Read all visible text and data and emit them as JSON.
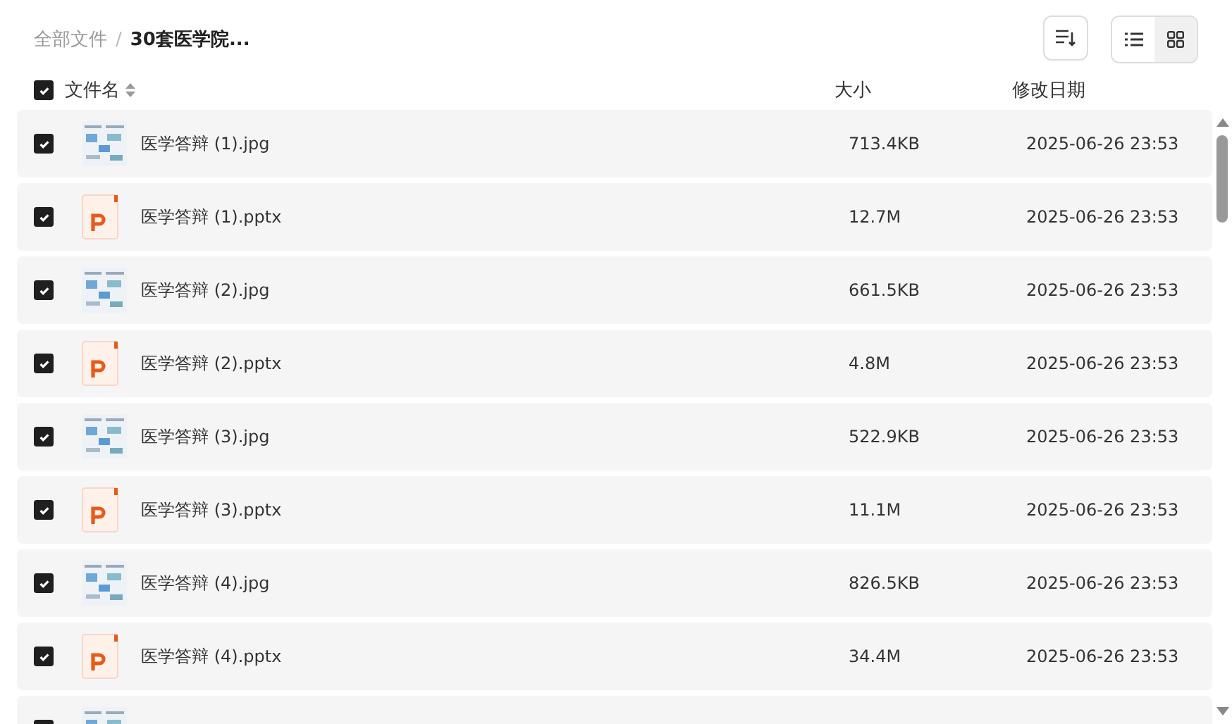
{
  "breadcrumb_separator": "/",
  "breadcrumb": [
    {
      "label": "全部文件",
      "current": false
    },
    {
      "label": "30套医学院...",
      "current": true
    }
  ],
  "view_toggle": [
    {
      "kind": "list",
      "selected": false
    },
    {
      "kind": "grid",
      "selected": true
    }
  ],
  "header": {
    "checked": true,
    "columns": [
      "文件名",
      "大小",
      "修改日期"
    ]
  },
  "files": [
    {
      "kind": "image",
      "checked": true,
      "name": "医学答辩 (1).jpg",
      "size": "713.4KB",
      "date": "2025-06-26 23:53"
    },
    {
      "kind": "pptx",
      "checked": true,
      "name": "医学答辩 (1).pptx",
      "size": "12.7M",
      "date": "2025-06-26 23:53"
    },
    {
      "kind": "image",
      "checked": true,
      "name": "医学答辩 (2).jpg",
      "size": "661.5KB",
      "date": "2025-06-26 23:53"
    },
    {
      "kind": "pptx",
      "checked": true,
      "name": "医学答辩 (2).pptx",
      "size": "4.8M",
      "date": "2025-06-26 23:53"
    },
    {
      "kind": "image",
      "checked": true,
      "name": "医学答辩 (3).jpg",
      "size": "522.9KB",
      "date": "2025-06-26 23:53"
    },
    {
      "kind": "pptx",
      "checked": true,
      "name": "医学答辩 (3).pptx",
      "size": "11.1M",
      "date": "2025-06-26 23:53"
    },
    {
      "kind": "image",
      "checked": true,
      "name": "医学答辩 (4).jpg",
      "size": "826.5KB",
      "date": "2025-06-26 23:53"
    },
    {
      "kind": "pptx",
      "checked": true,
      "name": "医学答辩 (4).pptx",
      "size": "34.4M",
      "date": "2025-06-26 23:53"
    },
    {
      "kind": "image",
      "checked": true
    }
  ]
}
